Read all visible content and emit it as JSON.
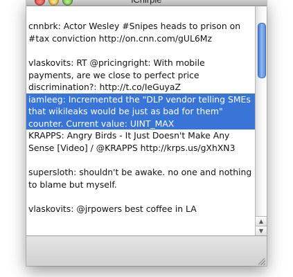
{
  "window": {
    "title": "iChirpie"
  },
  "timeline": {
    "tweets": [
      {
        "text": "cnnbrk: Actor Wesley #Snipes heads to prison on #tax conviction http://on.cnn.com/gUL6Mz",
        "selected": false
      },
      {
        "text": "vlaskovits: RT @pricingright: With mobile payments, are we close to perfect price discrimination?: http://t.co/IeGuyaZ",
        "selected": false
      },
      {
        "text": "iamleeg: Incremented the \"DLP vendor telling SMEs that wikileaks would be just as bad for them\" counter. Current value: UINT_MAX",
        "selected": true
      },
      {
        "text": "KRAPPS: Angry Birds - It Just Doesn't Make Any Sense [Video] / @KRAPPS http://krps.us/gXhXN3",
        "selected": false
      },
      {
        "text": "supersloth: shouldn't be awake. no one and nothing to blame but myself.",
        "selected": false
      },
      {
        "text": "vlaskovits: @jrpowers best coffee in LA",
        "selected": false
      }
    ]
  },
  "colors": {
    "selection": "#3875d7",
    "scroll_thumb": "#5a8fdc"
  },
  "icons": {
    "close": "close-button-icon",
    "minimize": "minimize-button-icon",
    "zoom": "zoom-button-icon",
    "scroll_up": "scroll-up-arrow-icon",
    "scroll_down": "scroll-down-arrow-icon"
  }
}
